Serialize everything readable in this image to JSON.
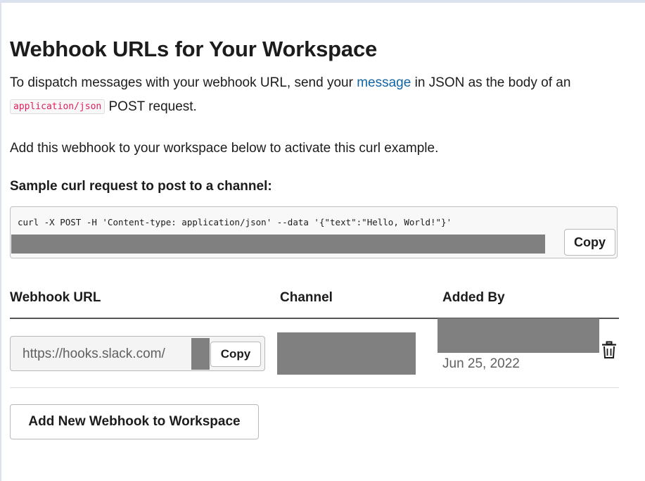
{
  "page": {
    "title": "Webhook URLs for Your Workspace",
    "intro_before_link": "To dispatch messages with your webhook URL, send your ",
    "intro_link": "message",
    "intro_after_link": " in JSON as the body of an ",
    "intro_code": "application/json",
    "intro_end": " POST request.",
    "activate_text": "Add this webhook to your workspace below to activate this curl example."
  },
  "sample": {
    "label": "Sample curl request to post to a channel:",
    "curl": "curl -X POST -H 'Content-type: application/json' --data '{\"text\":\"Hello, World!\"}'",
    "copy_label": "Copy"
  },
  "table": {
    "headers": {
      "url": "Webhook URL",
      "channel": "Channel",
      "added_by": "Added By"
    },
    "rows": [
      {
        "url": "https://hooks.slack.com/",
        "copy_label": "Copy",
        "date": "Jun 25, 2022",
        "delete_icon": "trash-icon"
      }
    ]
  },
  "actions": {
    "add_button": "Add New Webhook to Workspace"
  },
  "colors": {
    "link": "#1264a3",
    "code": "#e01e5a",
    "redaction": "#808080"
  }
}
